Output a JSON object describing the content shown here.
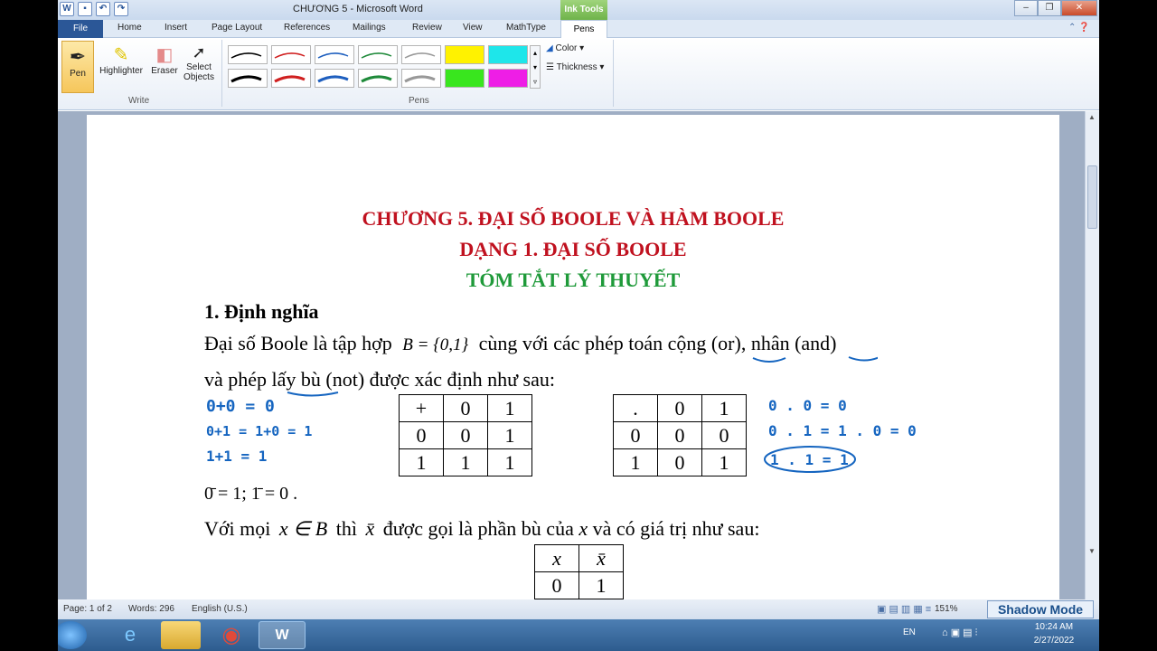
{
  "window": {
    "title": "CHƯƠNG 5 - Microsoft Word",
    "context_tab_group": "Ink Tools"
  },
  "tabs": [
    "File",
    "Home",
    "Insert",
    "Page Layout",
    "References",
    "Mailings",
    "Review",
    "View",
    "MathType",
    "Pens"
  ],
  "ribbon": {
    "write_group": "Write",
    "pens_group": "Pens",
    "buttons": {
      "pen": "Pen",
      "highlighter": "Highlighter",
      "eraser": "Eraser",
      "select": "Select",
      "objects": "Objects",
      "color": "Color",
      "thickness": "Thickness"
    }
  },
  "document": {
    "heading1": "CHƯƠNG 5. ĐẠI SỐ BOOLE VÀ HÀM BOOLE",
    "heading2": "DẠNG 1. ĐẠI SỐ BOOLE",
    "heading3": "TÓM TẮT LÝ THUYẾT",
    "section": "1. Định nghĩa",
    "para1a": "Đại số Boole là tập hợp",
    "set_expr": "B = {0,1}",
    "para1b": "cùng với các phép toán cộng (or), nhân (and)",
    "para2": "và phép lấy bù (not) được xác định như sau:",
    "complement_line": "0̄ = 1;  1̄ = 0 .",
    "para3a": "Với mọi",
    "para3expr": "x ∈ B",
    "para3b": "thì",
    "para3xbar": "x̄",
    "para3c": "được gọi là phần bù của",
    "para3x": "x",
    "para3d": "và có giá trị như sau:",
    "or_table": [
      [
        "+",
        "0",
        "1"
      ],
      [
        "0",
        "0",
        "1"
      ],
      [
        "1",
        "1",
        "1"
      ]
    ],
    "and_table": [
      [
        ".",
        "0",
        "1"
      ],
      [
        "0",
        "0",
        "0"
      ],
      [
        "1",
        "0",
        "1"
      ]
    ],
    "not_table": [
      [
        "x",
        "x̄"
      ],
      [
        "0",
        "1"
      ]
    ],
    "ink_left": [
      "0+0 = 0",
      "0+1 = 1+0 = 1",
      "1+1 = 1"
    ],
    "ink_right": [
      "0 . 0 = 0",
      "0 . 1 = 1 . 0 = 0",
      "1 . 1 = 1"
    ]
  },
  "status": {
    "page": "Page: 1 of 2",
    "words": "Words: 296",
    "language": "English (U.S.)",
    "zoom": "151%",
    "shadow_mode": "Shadow Mode"
  },
  "taskbar": {
    "lang": "EN",
    "time": "10:24 AM",
    "date": "2/27/2022"
  },
  "colors": {
    "heading_red": "#c0111f",
    "heading_green": "#1f9a3a",
    "ink_blue": "#1565c0"
  }
}
